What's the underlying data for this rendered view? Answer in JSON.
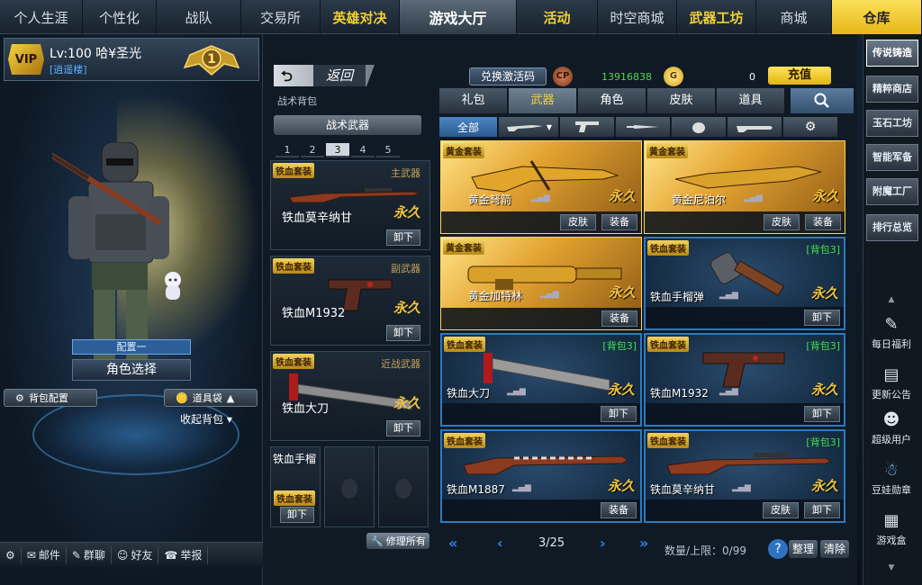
{
  "topnav": {
    "tabs": [
      "个人生涯",
      "个性化",
      "战队",
      "交易所",
      "英雄对决",
      "游戏大厅",
      "活动",
      "时空商城",
      "武器工坊",
      "商城",
      "仓库"
    ]
  },
  "profile": {
    "vip": "VIP",
    "level_name": "Lv:100 哈¥圣光",
    "guild": "[逍遥楼]",
    "rank_num": "1"
  },
  "character": {
    "config_label": "配置一",
    "role_select": "角色选择",
    "bag_config": "背包配置",
    "item_bag": "道具袋",
    "collapse_bag": "收起背包"
  },
  "bottombar": {
    "mail": "邮件",
    "group_chat": "群聊",
    "friends": "好友",
    "report": "举报"
  },
  "loadout": {
    "back": "返回",
    "tactical_bag": "战术背包",
    "header": "战术武器",
    "pages": [
      "1",
      "2",
      "3",
      "4",
      "5"
    ],
    "active_page": "3",
    "slots": [
      {
        "badge": "铁血套装",
        "category": "主武器",
        "name": "铁血莫辛纳甘",
        "duration": "永久",
        "action": "卸下"
      },
      {
        "badge": "铁血套装",
        "category": "副武器",
        "name": "铁血M1932",
        "duration": "永久",
        "action": "卸下"
      },
      {
        "badge": "铁血套装",
        "category": "近战武器",
        "name": "铁血大刀",
        "duration": "永久",
        "action": "卸下"
      }
    ],
    "grenade": {
      "name": "铁血手榴",
      "badge": "铁血套装",
      "action": "卸下"
    },
    "repair_all": "修理所有"
  },
  "currency": {
    "redeem": "兑换激活码",
    "cp_icon": "CP",
    "cp_value": "13916838",
    "g_icon": "G",
    "g_value": "0",
    "recharge": "充值"
  },
  "category_tabs": [
    "礼包",
    "武器",
    "角色",
    "皮肤",
    "道具"
  ],
  "active_category": "武器",
  "sub_tabs": {
    "all": "全部"
  },
  "inventory": [
    {
      "style": "gold",
      "badge": "黄金套装",
      "name": "黄金弩箭",
      "duration": "永久",
      "bag": "",
      "buttons": [
        "皮肤",
        "装备"
      ]
    },
    {
      "style": "gold",
      "badge": "黄金套装",
      "name": "黄金尼泊尔",
      "duration": "永久",
      "bag": "",
      "buttons": [
        "皮肤",
        "装备"
      ]
    },
    {
      "style": "gold",
      "badge": "黄金套装",
      "name": "黄金加特林",
      "duration": "永久",
      "bag": "",
      "buttons": [
        "装备"
      ]
    },
    {
      "style": "blue",
      "badge": "铁血套装",
      "name": "铁血手榴弹",
      "duration": "永久",
      "bag": "[背包3]",
      "buttons": [
        "卸下"
      ]
    },
    {
      "style": "blue",
      "badge": "铁血套装",
      "name": "铁血大刀",
      "duration": "永久",
      "bag": "[背包3]",
      "buttons": [
        "卸下"
      ]
    },
    {
      "style": "blue",
      "badge": "铁血套装",
      "name": "铁血M1932",
      "duration": "永久",
      "bag": "[背包3]",
      "buttons": [
        "卸下"
      ]
    },
    {
      "style": "blue",
      "badge": "铁血套装",
      "name": "铁血M1887",
      "duration": "永久",
      "bag": "",
      "buttons": [
        "装备"
      ]
    },
    {
      "style": "blue",
      "badge": "铁血套装",
      "name": "铁血莫辛纳甘",
      "duration": "永久",
      "bag": "[背包3]",
      "buttons": [
        "皮肤",
        "卸下"
      ]
    }
  ],
  "pager": {
    "current": "3/25",
    "capacity": "数量/上限：0/99",
    "help": "?",
    "sort": "整理",
    "clear": "清除"
  },
  "sidebar": {
    "shops": [
      "传说铸造",
      "精粹商店",
      "玉石工坊",
      "智能军备",
      "附魔工厂",
      "排行总览"
    ],
    "links": [
      "每日福利",
      "更新公告",
      "超级用户",
      "豆娃勋章",
      "游戏盒"
    ]
  },
  "colors": {
    "gold_accent": "#f1cf33",
    "blue_border": "#2b7bc1",
    "bag_green": "#42e04b"
  }
}
